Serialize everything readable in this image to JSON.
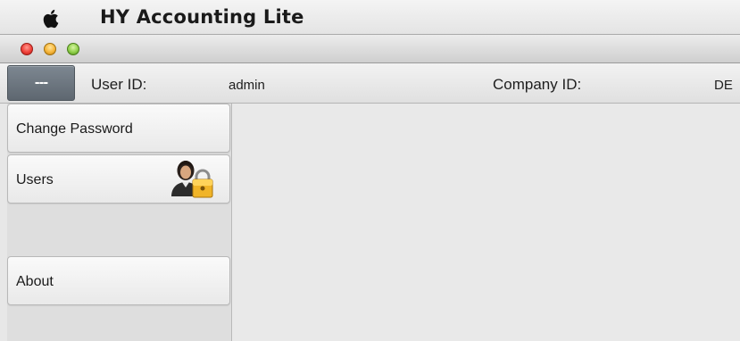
{
  "menubar": {
    "apple_icon": "apple-logo-icon",
    "app_name": "HY Accounting Lite"
  },
  "window": {
    "controls": [
      "close",
      "minimize",
      "zoom"
    ],
    "colors": {
      "close": "#f0413a",
      "minimize": "#f6b53a",
      "zoom": "#8fcf4a"
    }
  },
  "infobar": {
    "toggle_label": "---",
    "user_id_label": "User ID:",
    "user_id_value": "admin",
    "company_id_label": "Company ID:",
    "company_id_value": "DE"
  },
  "sidebar": {
    "items": [
      {
        "label": "Change Password",
        "icon": null
      },
      {
        "label": "Users",
        "icon": "user-lock-icon"
      },
      {
        "label": "About",
        "icon": null
      }
    ]
  }
}
